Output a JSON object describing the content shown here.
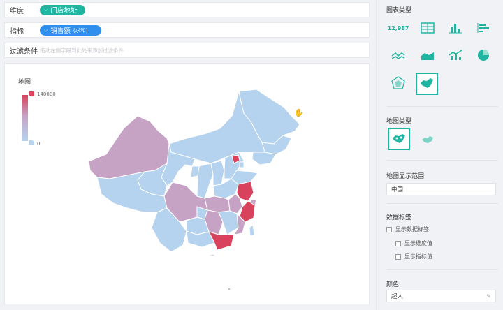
{
  "left": {
    "dimension_label": "维度",
    "dimension_pill": "门店地址",
    "metric_label": "指标",
    "metric_pill": "销售额",
    "metric_pill_sub": "(求和)",
    "filter_label": "过滤条件",
    "filter_hint": "拖动左侧字段到此处来添加过滤条件"
  },
  "chart": {
    "title": "地图",
    "visual_map_max": "140000",
    "visual_map_min": "0",
    "colors": {
      "high": "#d9425d",
      "mid": "#c6a3c4",
      "low": "#b5d3ef"
    }
  },
  "panel": {
    "chart_type_title": "图表类型",
    "chart_type_icons": [
      "kpi-number-icon",
      "table-icon",
      "bar-chart-icon",
      "horizontal-bar-icon",
      "line-chart-icon",
      "area-chart-icon",
      "combo-chart-icon",
      "pie-chart-icon",
      "radar-chart-icon",
      "map-chart-icon"
    ],
    "kpi_text": "12,987",
    "map_type_title": "地图类型",
    "map_range_title": "地图显示范围",
    "map_range_value": "中国",
    "data_label_title": "数据标签",
    "show_data_label": "显示数据标签",
    "show_dimension_value": "显示维度值",
    "show_metric_value": "显示指标值",
    "color_title": "颜色",
    "color_value": "超人",
    "accent": "#1fb5a0"
  }
}
